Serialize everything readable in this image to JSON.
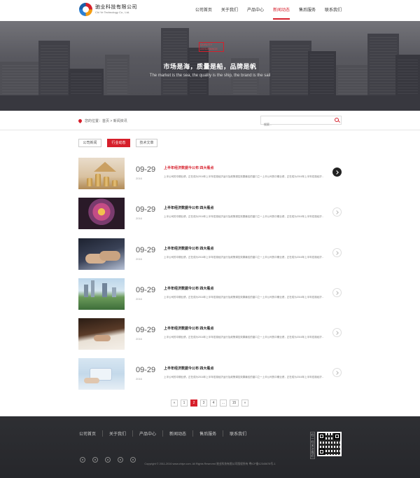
{
  "header": {
    "logo_cn": "驰业科技有限公司",
    "logo_en": "Chi Ye Technology Co., Ltd.",
    "nav": [
      "公司首页",
      "关于我们",
      "产品中心",
      "新闻动态",
      "售后服务",
      "联系我们"
    ],
    "active_nav": 3
  },
  "banner": {
    "tag_line1": "QUALITY",
    "tag_line2": "ASSURANCE",
    "title": "市场是海，质量是船，品牌是帆",
    "subtitle": "The market is the sea, the quality is the ship, the brand is the sail"
  },
  "breadcrumb": {
    "text": "您的位置：首页 > 新闻资讯"
  },
  "search": {
    "placeholder": "搜索..."
  },
  "tabs": [
    "公司新闻",
    "行业动态",
    "技术文章"
  ],
  "news": [
    {
      "date": "09-29",
      "year": "2016",
      "title": "上半年经济数据今公布 四大看点",
      "desc": "上半公司的中期业绩，正在成为2016年上半年宏观经济运行及政策调控效果最佳的窗口之一上半公司的中期业绩，正在成为2016年上半年宏观经济..."
    },
    {
      "date": "09-29",
      "year": "2016",
      "title": "上半年经济数据今公布 四大看点",
      "desc": "上半公司的中期业绩，正在成为2016年上半年宏观经济运行及政策调控效果最佳的窗口之一上半公司的中期业绩，正在成为2016年上半年宏观经济..."
    },
    {
      "date": "09-29",
      "year": "2016",
      "title": "上半年经济数据今公布 四大看点",
      "desc": "上半公司的中期业绩，正在成为2016年上半年宏观经济运行及政策调控效果最佳的窗口之一上半公司的中期业绩，正在成为2016年上半年宏观经济..."
    },
    {
      "date": "09-29",
      "year": "2016",
      "title": "上半年经济数据今公布 四大看点",
      "desc": "上半公司的中期业绩，正在成为2016年上半年宏观经济运行及政策调控效果最佳的窗口之一上半公司的中期业绩，正在成为2016年上半年宏观经济..."
    },
    {
      "date": "09-29",
      "year": "2016",
      "title": "上半年经济数据今公布 四大看点",
      "desc": "上半公司的中期业绩，正在成为2016年上半年宏观经济运行及政策调控效果最佳的窗口之一上半公司的中期业绩，正在成为2016年上半年宏观经济..."
    },
    {
      "date": "09-29",
      "year": "2016",
      "title": "上半年经济数据今公布 四大看点",
      "desc": "上半公司的中期业绩，正在成为2016年上半年宏观经济运行及政策调控效果最佳的窗口之一上半公司的中期业绩，正在成为2016年上半年宏观经济..."
    }
  ],
  "pager": {
    "prev": "«",
    "pages": [
      "1",
      "2",
      "3",
      "4",
      "...",
      "15"
    ],
    "next": "»",
    "current": "2"
  },
  "footer": {
    "nav": [
      "公司首页",
      "关于我们",
      "产品中心",
      "新闻动态",
      "售后服务",
      "联系我们"
    ],
    "qr_label": "扫一扫关注我们",
    "copyright": "Copyright © 2011-2016 www.chiye.com. All Rights Reserved 驰业科技有限公司版权所有 粤ICP备12345678号-1"
  },
  "colors": {
    "accent": "#d61f2b",
    "footer_bg": "#2e2f33"
  }
}
